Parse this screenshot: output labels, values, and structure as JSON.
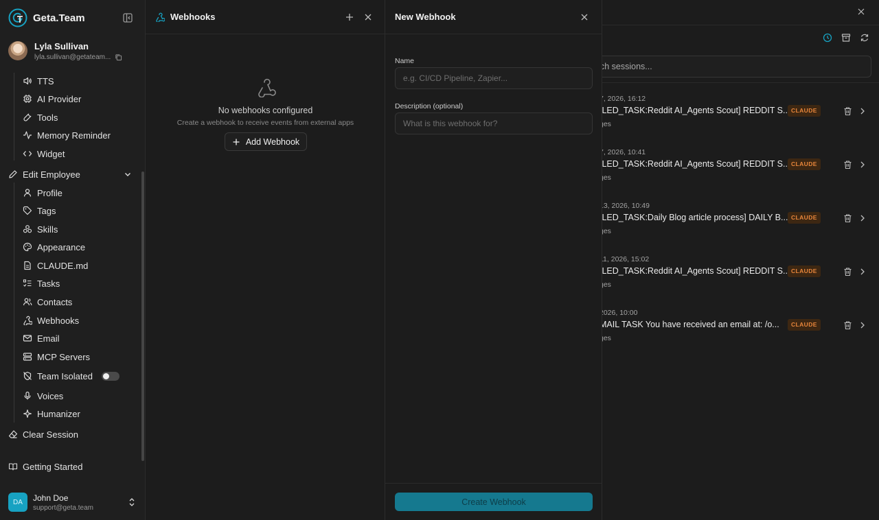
{
  "brand": {
    "name": "Geta.Team"
  },
  "current_user": {
    "name": "Lyla Sullivan",
    "email": "lyla.sullivan@getateam..."
  },
  "nav": {
    "tts": "TTS",
    "ai_provider": "AI Provider",
    "tools": "Tools",
    "memory_reminder": "Memory Reminder",
    "widget": "Widget",
    "edit_employee": "Edit Employee",
    "profile": "Profile",
    "tags": "Tags",
    "skills": "Skills",
    "appearance": "Appearance",
    "claude_md": "CLAUDE.md",
    "tasks": "Tasks",
    "contacts": "Contacts",
    "webhooks": "Webhooks",
    "email": "Email",
    "mcp_servers": "MCP Servers",
    "team_isolated": "Team Isolated",
    "voices": "Voices",
    "humanizer": "Humanizer",
    "clear_session": "Clear Session",
    "getting_started": "Getting Started"
  },
  "account": {
    "initials": "DA",
    "name": "John Doe",
    "email": "support@geta.team"
  },
  "webhooks_panel": {
    "title": "Webhooks",
    "empty_title": "No webhooks configured",
    "empty_subtitle": "Create a webhook to receive events from external apps",
    "add_button": "Add Webhook"
  },
  "new_webhook": {
    "title": "New Webhook",
    "name_label": "Name",
    "name_placeholder": "e.g. CI/CD Pipeline, Zapier...",
    "description_label": "Description (optional)",
    "description_placeholder": "What is this webhook for?",
    "create_button": "Create Webhook"
  },
  "sessions": {
    "search_placeholder": "ch sessions...",
    "items": [
      {
        "date": "7, 2026, 16:12",
        "title": "ILED_TASK:Reddit AI_Agents Scout] REDDIT S...",
        "badge": "CLAUDE",
        "meta": "ges"
      },
      {
        "date": "7, 2026, 10:41",
        "title": "ILED_TASK:Reddit AI_Agents Scout] REDDIT S...",
        "badge": "CLAUDE",
        "meta": "ges"
      },
      {
        "date": "13, 2026, 10:49",
        "title": "ILED_TASK:Daily Blog article process] DAILY B...",
        "badge": "CLAUDE",
        "meta": "ges"
      },
      {
        "date": "11, 2026, 15:02",
        "title": "ILED_TASK:Reddit AI_Agents Scout] REDDIT S...",
        "badge": "CLAUDE",
        "meta": "ges"
      },
      {
        "date": "2026, 10:00",
        "title": "MAIL TASK You have received an email at: /o...",
        "badge": "CLAUDE",
        "meta": "ges"
      }
    ]
  },
  "colors": {
    "accent": "#17a2c2",
    "badge_text": "#e8863b",
    "badge_bg": "#3d2712",
    "primary_button": "#15798f"
  }
}
